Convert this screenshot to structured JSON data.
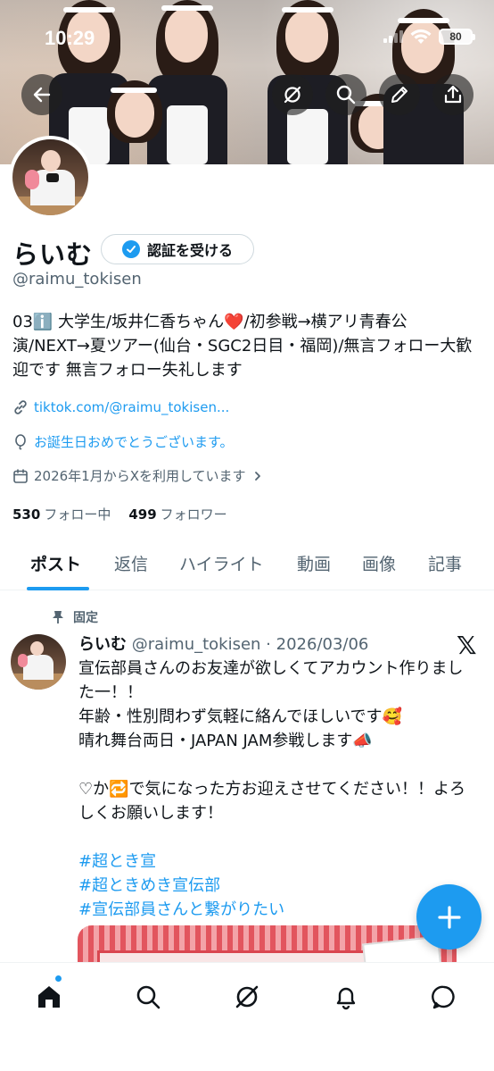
{
  "status_bar": {
    "time": "10:29",
    "battery": "80"
  },
  "profile": {
    "display_name": "らいむ",
    "verify_label": "認証を受ける",
    "handle": "@raimu_tokisen",
    "bio": "03ℹ️ 大学生/坂井仁香ちゃん❤️/初参戦→横アリ青春公演/NEXT→夏ツアー(仙台・SGC2日目・福岡)/無言フォロー大歓迎です 無言フォロー失礼します",
    "link": "tiktok.com/@raimu_tokisen...",
    "birthday": "お誕生日おめでとうございます。",
    "joined": "2026年1月からXを利用しています",
    "following_count": "530",
    "following_label": "フォロー中",
    "followers_count": "499",
    "followers_label": "フォロワー"
  },
  "tabs": [
    "ポスト",
    "返信",
    "ハイライト",
    "動画",
    "画像",
    "記事"
  ],
  "pinned_tweet": {
    "pinned_label": "固定",
    "name": "らいむ",
    "meta": "@raimu_tokisen · 2026/03/06",
    "lines": [
      "宣伝部員さんのお友達が欲しくてアカウント作りました一！！",
      "年齢・性別問わず気軽に絡んでほしいです🥰",
      "晴れ舞台両日・JAPAN JAM参戦します📣",
      "",
      "♡か🔁で気になった方お迎えさせてください！！よろしくお願いします！",
      ""
    ],
    "hashtags": [
      "#超とき宣",
      "#超ときめき宣伝部",
      "#宣伝部員さんと繋がりたい"
    ]
  },
  "colors": {
    "accent": "#1d9bf0",
    "text": "#0f1419",
    "muted": "#536471"
  },
  "icons": {
    "back": "arrow-left-icon",
    "grok": "grok-icon",
    "search": "search-icon",
    "edit": "pencil-icon",
    "share": "share-icon",
    "nav": [
      "home-icon",
      "search-icon",
      "grok-icon",
      "bell-icon",
      "message-icon"
    ]
  }
}
